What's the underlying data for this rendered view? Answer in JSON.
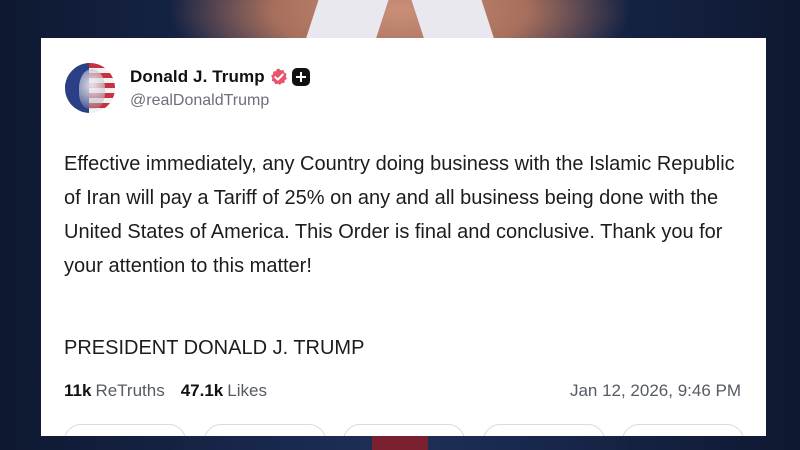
{
  "post": {
    "author": {
      "display_name": "Donald J. Trump",
      "handle": "@realDonaldTrump",
      "verified_color": "#e8546e"
    },
    "body": "Effective immediately, any Country doing business with the Islamic Republic of Iran will pay a Tariff of 25% on any and all business being done with the United States of America. This Order is final and conclusive. Thank you for your attention to this matter!",
    "signature": "PRESIDENT DONALD J. TRUMP",
    "stats": {
      "retruths_count": "11k",
      "retruths_label": "ReTruths",
      "likes_count": "47.1k",
      "likes_label": "Likes"
    },
    "timestamp": "Jan 12, 2026, 9:46 PM",
    "actions": [
      "reply-action",
      "retruth-action",
      "like-action",
      "share-action",
      "more-action"
    ]
  },
  "icons": {
    "verified": "verified-badge-icon",
    "plus": "plus-badge-icon"
  },
  "colors": {
    "card_background": "#ffffff",
    "text_primary": "#1c1c1e",
    "text_secondary": "#555a64",
    "backdrop": "#17264a"
  }
}
